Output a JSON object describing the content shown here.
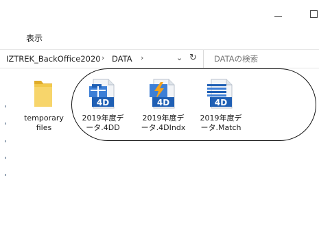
{
  "window": {
    "minimize_glyph": "—",
    "maximize_glyph": "□"
  },
  "menu": {
    "view_label": "表示"
  },
  "address": {
    "crumbs": [
      "IZTREK_BackOffice2020",
      "DATA"
    ],
    "separator": "›",
    "dropdown_glyph": "⌄",
    "refresh_glyph": "↻"
  },
  "search": {
    "placeholder": "DATAの検索"
  },
  "files": [
    {
      "label": "temporary\nfiles",
      "icon": "folder-icon"
    },
    {
      "label": "2019年度デ\nータ.4DD",
      "icon": "4d-data-file-icon"
    },
    {
      "label": "2019年度デ\nータ.4DIndx",
      "icon": "4d-index-file-icon"
    },
    {
      "label": "2019年度デ\nータ.Match",
      "icon": "4d-match-file-icon"
    }
  ],
  "colors": {
    "folder": "#f2c94c",
    "folder_dark": "#e0ac2a",
    "fourd_blue": "#1f5fb4",
    "fourd_light": "#3d7fd6",
    "lightning": "#f4a21b",
    "annotation": "#111111"
  }
}
